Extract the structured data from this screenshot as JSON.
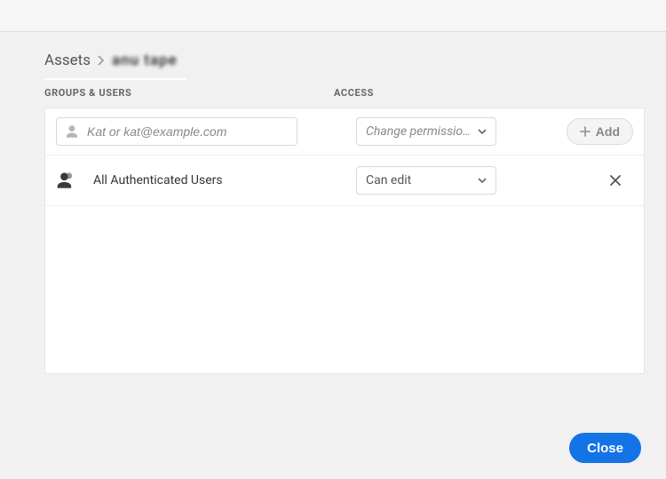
{
  "breadcrumb": {
    "root": "Assets",
    "current": "anu tape"
  },
  "headers": {
    "groups_users": "GROUPS & USERS",
    "access": "ACCESS"
  },
  "input_row": {
    "placeholder": "Kat or kat@example.com",
    "permission_placeholder": "Change permissio…",
    "add_label": "Add"
  },
  "rows": [
    {
      "name": "All Authenticated Users",
      "access": "Can edit"
    }
  ],
  "footer": {
    "close_label": "Close"
  }
}
